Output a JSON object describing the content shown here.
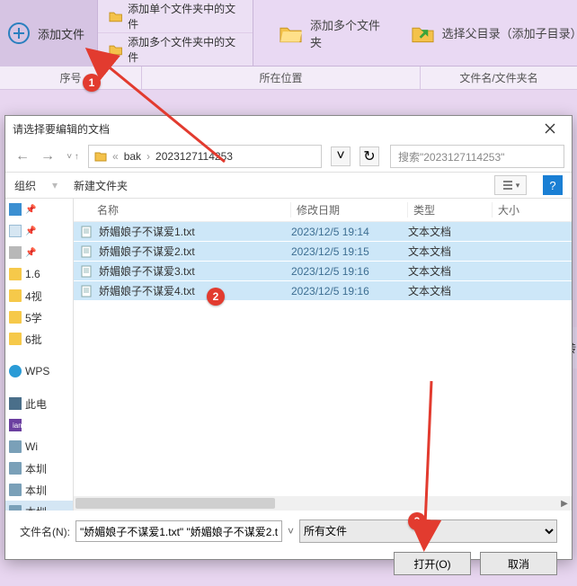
{
  "toolbar": {
    "add_file": "添加文件",
    "add_single_folder_files": "添加单个文件夹中的文件",
    "add_multi_folder_files": "添加多个文件夹中的文件",
    "add_folders": "添加多个文件夹",
    "select_parent": "选择父目录（添加子目录）"
  },
  "columns": {
    "c1": "序号",
    "c2": "所在位置",
    "c3": "文件名/文件夹名"
  },
  "badges": {
    "b1": "1",
    "b2": "2",
    "b3": "3"
  },
  "dialog": {
    "title": "请选择要编辑的文档",
    "breadcrumb": {
      "seg1": "bak",
      "seg2": "2023127114253"
    },
    "search_placeholder": "搜索\"2023127114253\"",
    "organize": "组织",
    "new_folder": "新建文件夹",
    "headers": {
      "name": "名称",
      "mdate": "修改日期",
      "type": "类型",
      "size": "大小"
    },
    "files": [
      {
        "name": "娇媚娘子不谋爱1.txt",
        "date": "2023/12/5 19:14",
        "type": "文本文档"
      },
      {
        "name": "娇媚娘子不谋爱2.txt",
        "date": "2023/12/5 19:15",
        "type": "文本文档"
      },
      {
        "name": "娇媚娘子不谋爱3.txt",
        "date": "2023/12/5 19:16",
        "type": "文本文档"
      },
      {
        "name": "娇媚娘子不谋爱4.txt",
        "date": "2023/12/5 19:16",
        "type": "文本文档"
      }
    ],
    "filename_label": "文件名(N):",
    "filename_value": "\"娇媚娘子不谋爱1.txt\" \"娇媚娘子不谋爱2.t",
    "filter": "所有文件",
    "open": "打开(O)",
    "cancel": "取消"
  },
  "sidebar": {
    "items": [
      {
        "label": "",
        "ico": "star"
      },
      {
        "label": "",
        "ico": "doc"
      },
      {
        "label": "",
        "ico": "gray"
      },
      {
        "label": "1.6",
        "ico": "folder"
      },
      {
        "label": "4视",
        "ico": "folder"
      },
      {
        "label": "5学",
        "ico": "folder"
      },
      {
        "label": "6批",
        "ico": "folder"
      },
      {
        "label": "",
        "ico": "blank"
      },
      {
        "label": "WPS",
        "ico": "wps"
      },
      {
        "label": "",
        "ico": "blank"
      },
      {
        "label": "此电",
        "ico": "pc"
      },
      {
        "label": "",
        "ico": "iam"
      },
      {
        "label": "Wi",
        "ico": "disk"
      },
      {
        "label": "本圳",
        "ico": "disk"
      },
      {
        "label": "本圳",
        "ico": "disk"
      },
      {
        "label": "本圳",
        "ico": "disk"
      }
    ]
  },
  "right_strip": "码转"
}
